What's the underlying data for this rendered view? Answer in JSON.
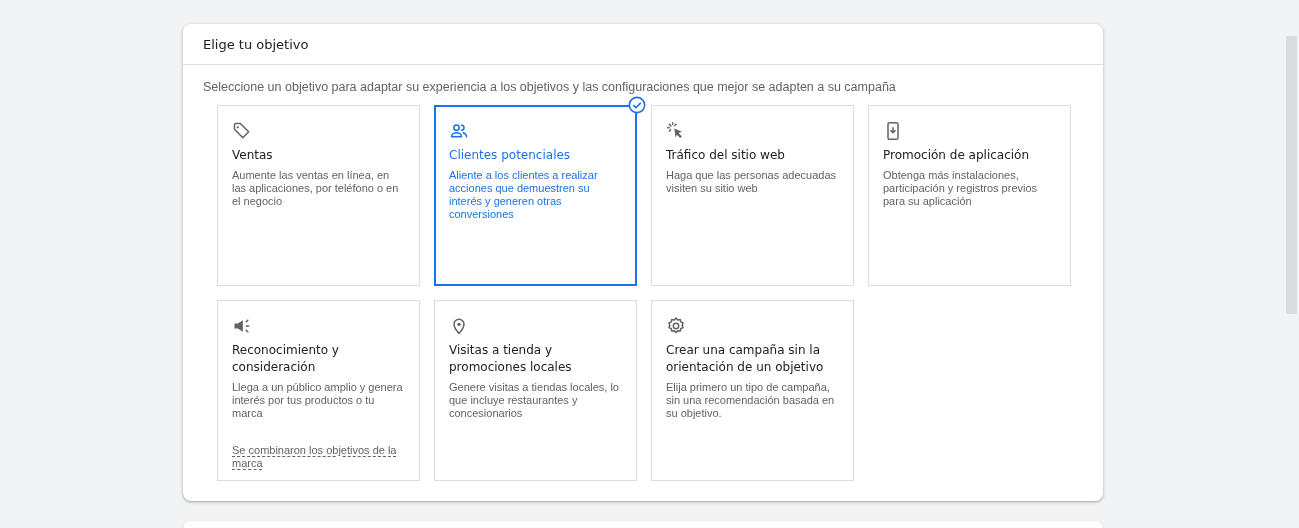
{
  "card": {
    "title": "Elige tu objetivo",
    "subtitle": "Seleccione un objetivo para adaptar su experiencia a los objetivos y las configuraciones que mejor se adapten a su campaña",
    "objectives": [
      {
        "kind": "tag",
        "title": "Ventas",
        "description": "Aumente las ventas en línea, en las aplicaciones, por teléfono o en el negocio",
        "selected": false
      },
      {
        "kind": "people",
        "title": "Clientes potenciales",
        "description": "Aliente a los clientes a realizar acciones que demuestren su interés y generen otras conversiones",
        "selected": true
      },
      {
        "kind": "cursor",
        "title": "Tráfico del sitio web",
        "description": "Haga que las personas adecuadas visiten su sitio web",
        "selected": false
      },
      {
        "kind": "phone",
        "title": "Promoción de aplicación",
        "description": "Obtenga más instalaciones, participación y registros previos para su aplicación",
        "selected": false
      },
      {
        "kind": "megaphone",
        "title": "Reconocimiento y consideración",
        "description": "Llega a un público amplio y genera interés por tus productos o tu marca",
        "link": "Se combinaron los objetivos de la marca",
        "selected": false
      },
      {
        "kind": "pin",
        "title": "Visitas a tienda y promociones locales",
        "description": "Genere visitas a tiendas locales, lo que incluye restaurantes y concesionarios",
        "selected": false
      },
      {
        "kind": "gear",
        "title": "Crear una campaña sin la orientación de un objetivo",
        "description": "Elija primero un tipo de campaña, sin una recomendación basada en su objetivo.",
        "selected": false
      }
    ]
  }
}
